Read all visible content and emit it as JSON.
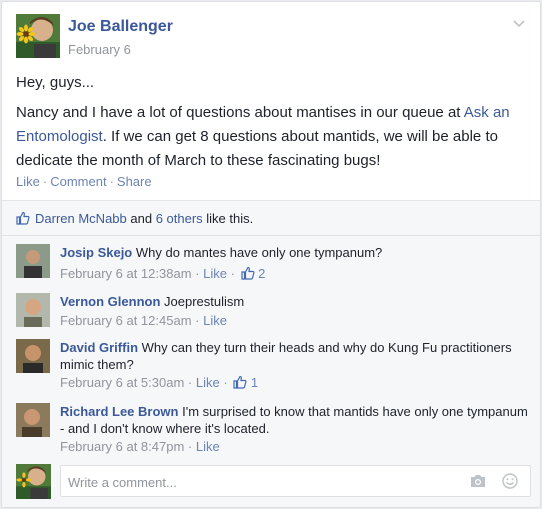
{
  "post": {
    "author": "Joe Ballenger",
    "date": "February 6",
    "greeting": "Hey, guys...",
    "body_before_link": "Nancy and I have a lot of questions about mantises in our queue at ",
    "link_text": "Ask an Entomologist",
    "body_after_link": ". If we can get 8 questions about mantids, we will be able to dedicate the month of March to these fascinating bugs!",
    "actions": {
      "like": "Like",
      "comment": "Comment",
      "share": "Share",
      "sep": "·"
    }
  },
  "likes": {
    "liker": "Darren McNabb",
    "and_text": " and ",
    "others": "6 others",
    "suffix": " like this."
  },
  "comments": [
    {
      "author": "Josip Skejo",
      "text": "Why do mantes have only one tympanum?",
      "time": "February 6 at 12:38am",
      "like": "Like",
      "likes": "2"
    },
    {
      "author": "Vernon Glennon",
      "text": "Joeprestulism",
      "time": "February 6 at 12:45am",
      "like": "Like",
      "likes": ""
    },
    {
      "author": "David Griffin",
      "text": "Why can they turn their heads and why do Kung Fu practitioners mimic them?",
      "time": "February 6 at 5:30am",
      "like": "Like",
      "likes": "1"
    },
    {
      "author": "Richard Lee Brown",
      "text": "I'm surprised to know that mantids have only one tympanum - and I don't know where it's located.",
      "time": "February 6 at 8:47pm",
      "like": "Like",
      "likes": ""
    }
  ],
  "compose": {
    "placeholder": "Write a comment..."
  },
  "meta_sep": " · ",
  "colors": {
    "link": "#3b5998",
    "muted": "#90949c",
    "bg": "#f6f7f9"
  },
  "icons": [
    "chevron-down-icon",
    "thumbs-up-icon",
    "camera-icon",
    "smiley-icon"
  ]
}
